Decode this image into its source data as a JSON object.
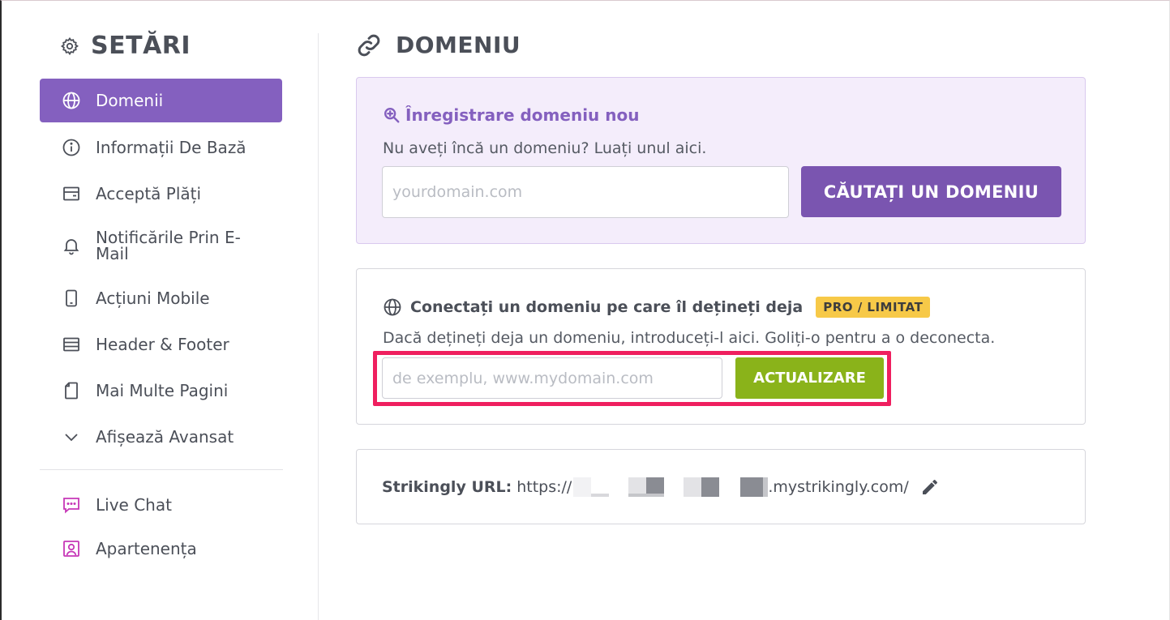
{
  "sidebar": {
    "title": "SETĂRI",
    "items": [
      {
        "label": "Domenii",
        "icon": "globe-icon",
        "active": true
      },
      {
        "label": "Informații De Bază",
        "icon": "info-icon"
      },
      {
        "label": "Acceptă Plăți",
        "icon": "wallet-icon"
      },
      {
        "label": "Notificările Prin E-Mail",
        "icon": "bell-icon"
      },
      {
        "label": "Acțiuni Mobile",
        "icon": "mobile-icon"
      },
      {
        "label": "Header & Footer",
        "icon": "layout-icon"
      },
      {
        "label": "Mai Multe Pagini",
        "icon": "page-icon"
      },
      {
        "label": "Afișează Avansat",
        "icon": "chevron-down-icon"
      }
    ],
    "bottom_items": [
      {
        "label": "Live Chat",
        "icon": "chat-icon"
      },
      {
        "label": "Apartenența",
        "icon": "member-icon"
      }
    ]
  },
  "main": {
    "title": "DOMENIU",
    "register": {
      "heading": "Înregistrare domeniu nou",
      "subtitle": "Nu aveți încă un domeniu? Luați unul aici.",
      "placeholder": "yourdomain.com",
      "button": "CĂUTAȚI UN DOMENIU"
    },
    "connect": {
      "heading": "Conectați un domeniu pe care îl dețineți deja",
      "badge": "PRO / LIMITAT",
      "subtitle": "Dacă dețineți deja un domeniu, introduceți-l aici. Goliți-o pentru a o deconecta.",
      "placeholder": "de exemplu, www.mydomain.com",
      "button": "ACTUALIZARE"
    },
    "url": {
      "label": "Strikingly URL:",
      "prefix": "https://",
      "suffix": ".mystrikingly.com/"
    }
  },
  "colors": {
    "accent": "#8460bf",
    "button_purple": "#7a55b0",
    "update_green": "#8ab31a",
    "highlight": "#ef1f5f",
    "badge": "#f7c948"
  }
}
